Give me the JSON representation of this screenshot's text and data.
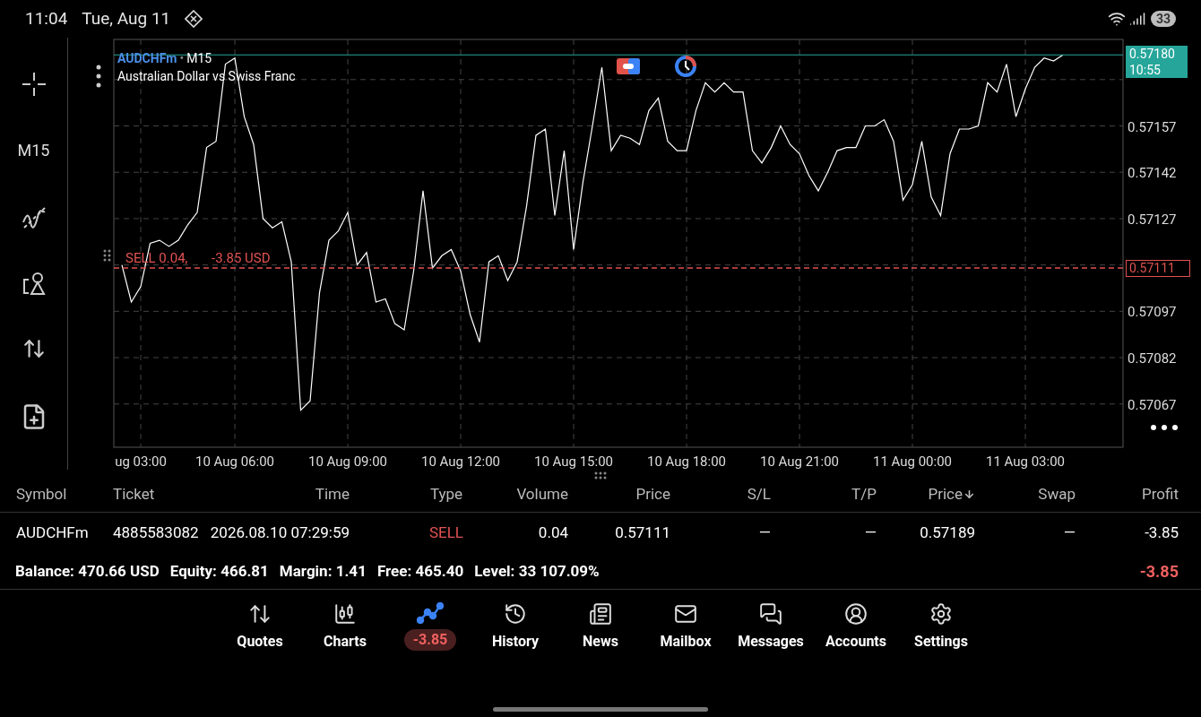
{
  "status_bar": {
    "time": "11:04",
    "date": "Tue, Aug 11",
    "battery": "33"
  },
  "toolbar": {
    "timeframe": "M15"
  },
  "chart": {
    "symbol": "AUDCHFm",
    "separator": "•",
    "timeframe": "M15",
    "description": "Australian Dollar vs Swiss Franc",
    "bid_line": {
      "price": "0.57180",
      "time": "10:55"
    },
    "order_line": {
      "label": "SELL 0.04,",
      "profit": "-3.85 USD",
      "price": "0.57111"
    },
    "chart_data": {
      "type": "line",
      "ylim": [
        0.57053,
        0.57185
      ],
      "grid": true,
      "ref_lines": [
        {
          "axis": "y",
          "value": 0.5718,
          "color": "#26a69a"
        },
        {
          "axis": "y",
          "value": 0.57111,
          "color": "#e05252"
        }
      ],
      "categories": [
        null,
        null,
        "ug 03:00",
        null,
        null,
        null,
        null,
        null,
        null,
        null,
        null,
        null,
        "10 Aug 06:00",
        null,
        null,
        null,
        null,
        null,
        null,
        null,
        null,
        null,
        null,
        null,
        "10 Aug 09:00",
        null,
        null,
        null,
        null,
        null,
        null,
        null,
        null,
        null,
        null,
        null,
        "10 Aug 12:00",
        null,
        null,
        null,
        null,
        null,
        null,
        null,
        null,
        null,
        null,
        null,
        "10 Aug 15:00",
        null,
        null,
        null,
        null,
        null,
        null,
        null,
        null,
        null,
        null,
        null,
        "10 Aug 18:00",
        null,
        null,
        null,
        null,
        null,
        null,
        null,
        null,
        null,
        null,
        null,
        "10 Aug 21:00",
        null,
        null,
        null,
        null,
        null,
        null,
        null,
        null,
        null,
        null,
        null,
        "11 Aug 00:00",
        null,
        null,
        null,
        null,
        null,
        null,
        null,
        null,
        null,
        null,
        null,
        "11 Aug 03:00",
        null,
        null,
        null,
        null
      ],
      "series": [
        {
          "color": "#ffffff",
          "values": [
            0.57112,
            0.571,
            0.57105,
            0.57119,
            0.5712,
            0.57118,
            0.5712,
            0.57125,
            0.57129,
            0.5715,
            0.57152,
            0.57177,
            0.57179,
            0.5716,
            0.57151,
            0.57127,
            0.57124,
            0.57126,
            0.57113,
            0.57065,
            0.57068,
            0.57103,
            0.5712,
            0.57123,
            0.57129,
            0.57112,
            0.57116,
            0.571,
            0.57101,
            0.57093,
            0.57091,
            0.5711,
            0.57136,
            0.57111,
            0.57115,
            0.57117,
            0.5711,
            0.57096,
            0.57087,
            0.57113,
            0.57115,
            0.57107,
            0.57113,
            0.57131,
            0.57154,
            0.57156,
            0.57128,
            0.57149,
            0.57117,
            0.57139,
            0.57157,
            0.57176,
            0.57149,
            0.57154,
            0.57153,
            0.57151,
            0.57162,
            0.57166,
            0.57152,
            0.57149,
            0.57149,
            0.57162,
            0.57171,
            0.57168,
            0.57171,
            0.57168,
            0.57168,
            0.57149,
            0.57145,
            0.5715,
            0.57157,
            0.57151,
            0.57148,
            0.57141,
            0.57136,
            0.57142,
            0.57149,
            0.5715,
            0.5715,
            0.57157,
            0.57157,
            0.57159,
            0.57152,
            0.57133,
            0.57138,
            0.57152,
            0.57134,
            0.57128,
            0.57148,
            0.57156,
            0.57156,
            0.57157,
            0.57171,
            0.57168,
            0.57177,
            0.5716,
            0.57169,
            0.57176,
            0.57179,
            0.57178,
            0.5718
          ]
        }
      ],
      "yticks": [
        {
          "value": 0.57157,
          "label": "0.57157"
        },
        {
          "value": 0.57142,
          "label": "0.57142"
        },
        {
          "value": 0.57127,
          "label": "0.57127"
        },
        {
          "value": 0.57097,
          "label": "0.57097"
        },
        {
          "value": 0.57082,
          "label": "0.57082"
        },
        {
          "value": 0.57067,
          "label": "0.57067"
        }
      ]
    }
  },
  "table": {
    "columns": [
      {
        "label": "Symbol",
        "sorted": false
      },
      {
        "label": "Ticket",
        "sorted": false
      },
      {
        "label": "Time",
        "sorted": false
      },
      {
        "label": "Type",
        "sorted": false
      },
      {
        "label": "Volume",
        "sorted": false
      },
      {
        "label": "Price",
        "sorted": false
      },
      {
        "label": "S/L",
        "sorted": false
      },
      {
        "label": "T/P",
        "sorted": false
      },
      {
        "label": "Price",
        "sorted": true
      },
      {
        "label": "Swap",
        "sorted": false
      },
      {
        "label": "Profit",
        "sorted": false
      }
    ],
    "rows": [
      {
        "kind": "sell",
        "cells": [
          "AUDCHFm",
          "4885583082",
          "2026.08.10 07:29:59",
          "SELL",
          "0.04",
          "0.57111",
          "—",
          "—",
          "0.57189",
          "—",
          "-3.85"
        ]
      }
    ]
  },
  "summary": {
    "items": [
      {
        "label": "Balance:",
        "value": "470.66 USD"
      },
      {
        "label": "Equity:",
        "value": "466.81"
      },
      {
        "label": "Margin:",
        "value": "1.41"
      },
      {
        "label": "Free:",
        "value": "465.40"
      },
      {
        "label": "Level:",
        "value": "33 107.09%"
      }
    ],
    "total": "-3.85"
  },
  "nav": [
    {
      "label": "Quotes",
      "selected": false
    },
    {
      "label": "Charts",
      "selected": false
    },
    {
      "badge": "-3.85",
      "selected": true
    },
    {
      "label": "History",
      "selected": false
    },
    {
      "label": "News",
      "selected": false
    },
    {
      "label": "Mailbox",
      "selected": false
    },
    {
      "label": "Messages",
      "selected": false
    },
    {
      "label": "Accounts",
      "selected": false
    },
    {
      "label": "Settings",
      "selected": false
    }
  ]
}
